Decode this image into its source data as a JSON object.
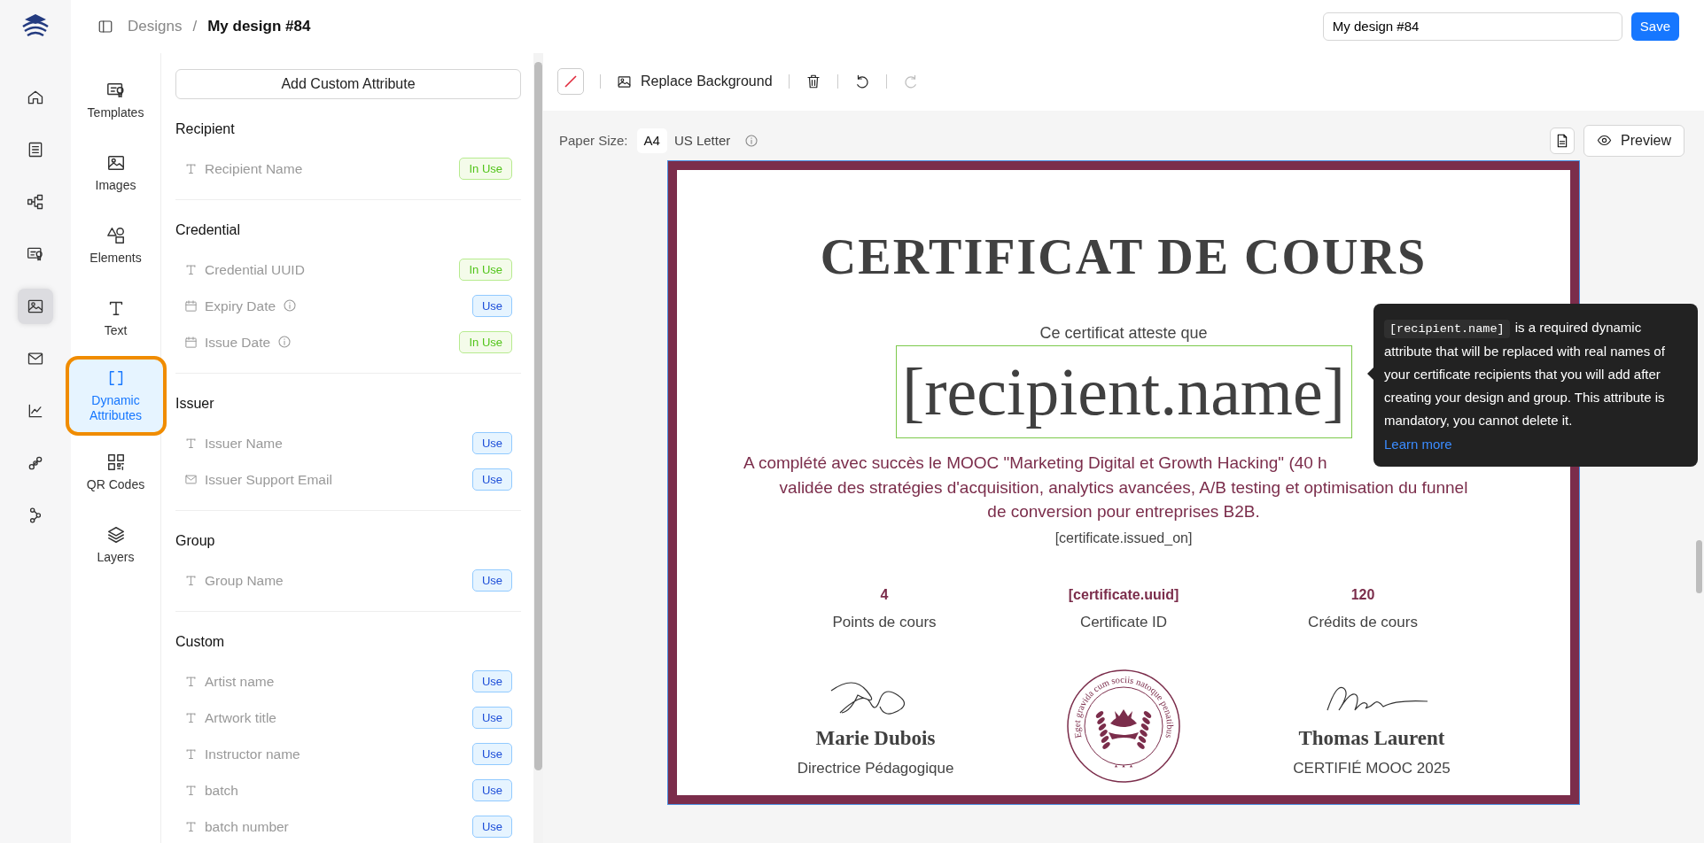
{
  "rail": [
    {
      "selected": false
    },
    {
      "selected": false
    },
    {
      "selected": false
    },
    {
      "selected": false
    },
    {
      "selected": true
    },
    {
      "selected": false
    },
    {
      "selected": false
    },
    {
      "selected": false
    },
    {
      "selected": false
    }
  ],
  "breadcrumb": {
    "parent": "Designs",
    "separator": "/",
    "current": "My design #84"
  },
  "design_name": {
    "value": "My design #84"
  },
  "save_button": "Save",
  "tools": [
    {
      "label": "Templates",
      "selected": false
    },
    {
      "label": "Images",
      "selected": false
    },
    {
      "label": "Elements",
      "selected": false
    },
    {
      "label": "Text",
      "selected": false
    },
    {
      "label": "Dynamic Attributes",
      "selected": true
    },
    {
      "label": "QR Codes",
      "selected": false
    },
    {
      "label": "Layers",
      "selected": false
    }
  ],
  "add_attribute_button": "Add Custom Attribute",
  "attribute_groups": [
    {
      "title": "Recipient",
      "items": [
        {
          "label": "Recipient Name",
          "kind": "text",
          "info": false,
          "action": "In Use",
          "in_use": true
        }
      ]
    },
    {
      "title": "Credential",
      "items": [
        {
          "label": "Credential UUID",
          "kind": "text",
          "info": false,
          "action": "In Use",
          "in_use": true
        },
        {
          "label": "Expiry Date",
          "kind": "date",
          "info": true,
          "action": "Use",
          "in_use": false
        },
        {
          "label": "Issue Date",
          "kind": "date",
          "info": true,
          "action": "In Use",
          "in_use": true
        }
      ]
    },
    {
      "title": "Issuer",
      "items": [
        {
          "label": "Issuer Name",
          "kind": "text",
          "info": false,
          "action": "Use",
          "in_use": false
        },
        {
          "label": "Issuer Support Email",
          "kind": "email",
          "info": false,
          "action": "Use",
          "in_use": false
        }
      ]
    },
    {
      "title": "Group",
      "items": [
        {
          "label": "Group Name",
          "kind": "text",
          "info": false,
          "action": "Use",
          "in_use": false
        }
      ]
    },
    {
      "title": "Custom",
      "items": [
        {
          "label": "Artist name",
          "kind": "text",
          "info": false,
          "action": "Use",
          "in_use": false
        },
        {
          "label": "Artwork title",
          "kind": "text",
          "info": false,
          "action": "Use",
          "in_use": false
        },
        {
          "label": "Instructor name",
          "kind": "text",
          "info": false,
          "action": "Use",
          "in_use": false
        },
        {
          "label": "batch",
          "kind": "text",
          "info": false,
          "action": "Use",
          "in_use": false
        },
        {
          "label": "batch number",
          "kind": "text",
          "info": false,
          "action": "Use",
          "in_use": false
        }
      ]
    }
  ],
  "toolbar": [
    {
      "kind": "color"
    },
    {
      "kind": "background",
      "label": "Replace Background"
    },
    {
      "kind": "delete",
      "disabled": false
    },
    {
      "kind": "undo",
      "disabled": false
    },
    {
      "kind": "redo",
      "disabled": true
    }
  ],
  "paper_size": {
    "label": "Paper Size:",
    "options": [
      {
        "label": "A4",
        "selected": true
      },
      {
        "label": "US Letter",
        "selected": false
      }
    ]
  },
  "preview_button": "Preview",
  "certificate": {
    "title": "CERTIFICAT DE COURS",
    "intro": "Ce certificat atteste que",
    "recipient": "[recipient.name]",
    "description_lines": [
      "A complété avec succès le MOOC \"Marketing Digital et Growth Hacking\" (40 h",
      "validée des stratégies d'acquisition, analytics avancées, A/B testing et optimisation du funnel",
      "de conversion pour entreprises B2B."
    ],
    "issued_on": "[certificate.issued_on]",
    "stats": [
      {
        "value": "4",
        "label": "Points de cours"
      },
      {
        "value": "[certificate.uuid]",
        "label": "Certificate ID"
      },
      {
        "value": "120",
        "label": "Crédits de cours"
      }
    ],
    "signatories": [
      {
        "name": "Marie Dubois",
        "role": "Directrice Pédagogique"
      },
      {
        "name": "Thomas Laurent",
        "role": "CERTIFIÉ MOOC 2025"
      }
    ],
    "seal_motto": "Eget gravida cum sociis natoque penatibus"
  },
  "tooltip": {
    "code": "[recipient.name]",
    "text": "is a required dynamic attribute that will be replaced with real names of your certificate recipients that you will add after creating your design and group. This attribute is mandatory, you cannot delete it.",
    "link": "Learn more"
  }
}
